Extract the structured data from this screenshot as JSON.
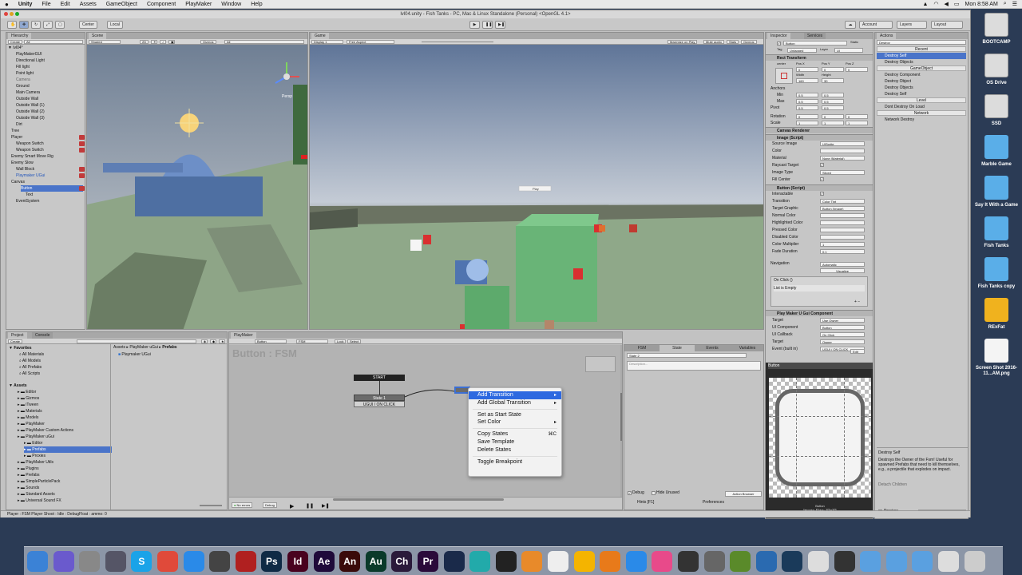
{
  "menubar": {
    "apple": "",
    "items": [
      "Unity",
      "File",
      "Edit",
      "Assets",
      "GameObject",
      "Component",
      "PlayMaker",
      "Window",
      "Help"
    ],
    "clock": "Mon 8:58 AM"
  },
  "window": {
    "title": "lvl04.unity - Fish Tanks - PC, Mac & Linux Standalone (Personal) <OpenGL 4.1>",
    "center_label": "Center",
    "local_label": "Local",
    "account": "Account",
    "layers": "Layers",
    "layout": "Layout"
  },
  "hierarchy": {
    "tab": "Hierarchy",
    "create": "Create",
    "search": "All",
    "scene": "lvl04*",
    "items": [
      {
        "label": "PlayMakerGUI",
        "indent": 1,
        "cls": "",
        "badge": false
      },
      {
        "label": "Directional Light",
        "indent": 1,
        "cls": "",
        "badge": false
      },
      {
        "label": "Fill light",
        "indent": 1,
        "cls": "",
        "badge": false
      },
      {
        "label": "Point light",
        "indent": 1,
        "cls": "",
        "badge": false
      },
      {
        "label": "Camera",
        "indent": 1,
        "cls": "grey",
        "badge": false
      },
      {
        "label": "Ground",
        "indent": 1,
        "cls": "",
        "badge": false
      },
      {
        "label": "Main Camera",
        "indent": 1,
        "cls": "",
        "badge": false
      },
      {
        "label": "Outside Wall",
        "indent": 1,
        "cls": "",
        "badge": false
      },
      {
        "label": "Outside Wall (1)",
        "indent": 1,
        "cls": "",
        "badge": false
      },
      {
        "label": "Outside Wall (2)",
        "indent": 1,
        "cls": "",
        "badge": false
      },
      {
        "label": "Outside Wall (3)",
        "indent": 1,
        "cls": "",
        "badge": false
      },
      {
        "label": "Dirt",
        "indent": 1,
        "cls": "",
        "badge": false
      },
      {
        "label": "Tree",
        "indent": 0,
        "cls": "",
        "badge": false
      },
      {
        "label": "Player",
        "indent": 0,
        "cls": "",
        "badge": true
      },
      {
        "label": "Weapon Switch",
        "indent": 1,
        "cls": "",
        "badge": true
      },
      {
        "label": "Weapon Switch",
        "indent": 1,
        "cls": "",
        "badge": true
      },
      {
        "label": "Enemy Smart Move Rig",
        "indent": 0,
        "cls": "",
        "badge": false
      },
      {
        "label": "Enemy Slow",
        "indent": 0,
        "cls": "",
        "badge": false
      },
      {
        "label": "Wall Block",
        "indent": 1,
        "cls": "",
        "badge": true
      },
      {
        "label": "Playmaker UGui",
        "indent": 1,
        "cls": "blue",
        "badge": true
      },
      {
        "label": "Canvas",
        "indent": 0,
        "cls": "",
        "badge": false
      },
      {
        "label": "Button",
        "indent": 2,
        "cls": "sel",
        "badge": true
      },
      {
        "label": "Text",
        "indent": 3,
        "cls": "",
        "badge": false
      },
      {
        "label": "EventSystem",
        "indent": 1,
        "cls": "",
        "badge": false
      }
    ]
  },
  "scene": {
    "tab": "Scene",
    "shading": "Shaded",
    "mode": "2D",
    "gizmos": "Gizmos",
    "search": "All",
    "persp": "Persp"
  },
  "game": {
    "tab": "Game",
    "display": "Display 1",
    "aspect": "Free Aspect",
    "maximize": "Maximize on Play",
    "mute": "Mute audio",
    "stats": "Stats",
    "gizmos": "Gizmos",
    "ui_button": "Play"
  },
  "inspector": {
    "tab": "Inspector",
    "services": "Services",
    "name": "Button",
    "static": "Static",
    "tag_label": "Tag",
    "tag": "Untagged",
    "layer_label": "Layer",
    "layer": "UI",
    "rect_transform": "Rect Transform",
    "anchor_preset": "center",
    "pos_x_lbl": "Pos X",
    "pos_y_lbl": "Pos Y",
    "pos_z_lbl": "Pos Z",
    "pos_x": "0",
    "pos_y": "0",
    "pos_z": "0",
    "width_lbl": "Width",
    "height_lbl": "Height",
    "width": "160",
    "height": "30",
    "anchors": "Anchors",
    "min": "Min",
    "max": "Max",
    "pivot": "Pivot",
    "anchor_min_x": "0.5",
    "anchor_min_y": "0.5",
    "anchor_max_x": "0.5",
    "anchor_max_y": "0.5",
    "pivot_x": "0.5",
    "pivot_y": "0.5",
    "rotation": "Rotation",
    "scale": "Scale",
    "rot_x": "0",
    "rot_y": "0",
    "rot_z": "0",
    "scale_x": "1",
    "scale_y": "1",
    "scale_z": "1",
    "canvas_renderer": "Canvas Renderer",
    "image_script": "Image (Script)",
    "image_fields": [
      {
        "label": "Source Image",
        "value": "UISprite"
      },
      {
        "label": "Color",
        "value": ""
      },
      {
        "label": "Material",
        "value": "None (Material)"
      },
      {
        "label": "Raycast Target",
        "value": "check"
      },
      {
        "label": "Image Type",
        "value": "Sliced"
      },
      {
        "label": "Fill Center",
        "value": "check"
      }
    ],
    "button_script": "Button (Script)",
    "button_fields": [
      {
        "label": "Interactable",
        "value": "check"
      },
      {
        "label": "Transition",
        "value": "Color Tint"
      },
      {
        "label": "Target Graphic",
        "value": "Button (Image)"
      },
      {
        "label": "Normal Color",
        "value": ""
      },
      {
        "label": "Highlighted Color",
        "value": ""
      },
      {
        "label": "Pressed Color",
        "value": ""
      },
      {
        "label": "Disabled Color",
        "value": ""
      },
      {
        "label": "Color Multiplier",
        "value": "1"
      },
      {
        "label": "Fade Duration",
        "value": "0.1"
      }
    ],
    "navigation": "Navigation",
    "navigation_value": "Automatic",
    "visualize": "Visualize",
    "onclick": "On Click ()",
    "list_empty": "List is Empty",
    "pm_component": "Play Maker U Gui Component",
    "pm_fields": [
      {
        "label": "Target",
        "value": "Use Owner"
      },
      {
        "label": "UI Component",
        "value": "Button"
      },
      {
        "label": "UI Callback",
        "value": "On Click"
      },
      {
        "label": "Target",
        "value": "Owner"
      },
      {
        "label": "Event (built in)",
        "value": "UGUI / ON CLICK"
      }
    ],
    "edit": "Edit",
    "preview_title": "Button",
    "preview_name": "Button",
    "image_size": "Image Size: 32x32"
  },
  "actions": {
    "tab": "Actions",
    "search": "Destroy",
    "sections": [
      {
        "header": "Recent",
        "items": [
          "Destroy Self",
          "Destroy Objects"
        ]
      },
      {
        "header": "GameObject",
        "items": [
          "Destroy Component",
          "Destroy Object",
          "Destroy Objects",
          "Destroy Self"
        ]
      },
      {
        "header": "Level",
        "items": [
          "Dont Destroy On Load"
        ]
      },
      {
        "header": "Network",
        "items": [
          "Network Destroy"
        ]
      }
    ],
    "selected": "Destroy Self",
    "desc_title": "Destroy Self",
    "description": "Destroys the Owner of the Fsm! Useful for spawned Prefabs that need to kill themselves, e.g., a projectile that explodes on impact.",
    "detach": "Detach Children",
    "preview": "Preview",
    "add_action": "Add Action To State"
  },
  "project": {
    "tab": "Project",
    "console": "Console",
    "create": "Create",
    "favorites": "Favorites",
    "fav_items": [
      "All Materials",
      "All Models",
      "All Prefabs",
      "All Scripts"
    ],
    "assets": "Assets",
    "asset_items": [
      {
        "label": "Editor",
        "indent": 1
      },
      {
        "label": "Gizmos",
        "indent": 1
      },
      {
        "label": "iTween",
        "indent": 1
      },
      {
        "label": "Materials",
        "indent": 1
      },
      {
        "label": "Models",
        "indent": 1
      },
      {
        "label": "PlayMaker",
        "indent": 1
      },
      {
        "label": "PlayMaker Custom Actions",
        "indent": 1
      },
      {
        "label": "PlayMaker uGui",
        "indent": 1
      },
      {
        "label": "Editor",
        "indent": 2
      },
      {
        "label": "Prefabs",
        "indent": 2
      },
      {
        "label": "Proxies",
        "indent": 2
      },
      {
        "label": "PlayMaker Utils",
        "indent": 1
      },
      {
        "label": "Plugins",
        "indent": 1
      },
      {
        "label": "Prefabs",
        "indent": 1
      },
      {
        "label": "SimpleParticlePack",
        "indent": 1
      },
      {
        "label": "Sounds",
        "indent": 1
      },
      {
        "label": "Standard Assets",
        "indent": 1
      },
      {
        "label": "Universal Sound FX",
        "indent": 1
      }
    ],
    "breadcrumb": [
      "Assets",
      "PlayMaker uGui",
      "Prefabs"
    ],
    "file": "Playmaker UGui"
  },
  "playmaker": {
    "tab": "PlayMaker",
    "object": "Button",
    "fsm": "FSM",
    "lock": "Lock",
    "select": "Select",
    "title": "Button : FSM",
    "start": "START",
    "state1": "State 1",
    "event1": "UGUI / ON CLICK",
    "side_tabs": [
      "FSM",
      "State",
      "Events",
      "Variables"
    ],
    "state_name": "State 2",
    "description": "Description...",
    "debug": "Debug",
    "hide_unused": "Hide Unused",
    "action_browser": "Action Browser",
    "hints": "Hints [F1]",
    "preferences": "Preferences",
    "no_errors": "No errors",
    "debug_btn": "Debug"
  },
  "context_menu": [
    {
      "label": "Add Transition",
      "arrow": true,
      "highlight": true
    },
    {
      "label": "Add Global Transition",
      "arrow": true
    },
    {
      "sep": true
    },
    {
      "label": "Set as Start State"
    },
    {
      "label": "Set Color",
      "arrow": true
    },
    {
      "sep": true
    },
    {
      "label": "Copy States",
      "shortcut": "⌘C"
    },
    {
      "label": "Save Template"
    },
    {
      "label": "Delete States"
    },
    {
      "sep": true
    },
    {
      "label": "Toggle Breakpoint"
    }
  ],
  "statusbar": "Player : FSM Player Shoot : Idle : DebugFloat : ammo: 0",
  "desktop": [
    {
      "label": "BOOTCAMP",
      "kind": "drive"
    },
    {
      "label": "OS Drive",
      "kind": "drive"
    },
    {
      "label": "SSD",
      "kind": "drive"
    },
    {
      "label": "Marble Game",
      "kind": "folder"
    },
    {
      "label": "Say It With a Game",
      "kind": "folder"
    },
    {
      "label": "Fish Tanks",
      "kind": "folder"
    },
    {
      "label": "Fish Tanks copy",
      "kind": "folder"
    },
    {
      "label": "RExFat",
      "kind": "ydrive"
    },
    {
      "label": "Screen Shot 2016-11...AM.png",
      "kind": "file"
    }
  ],
  "dock": [
    {
      "label": "",
      "color": "#3b82d6"
    },
    {
      "label": "",
      "color": "#6a5acd"
    },
    {
      "label": "",
      "color": "#888"
    },
    {
      "label": "",
      "color": "#556"
    },
    {
      "label": "S",
      "color": "#1aa3e8"
    },
    {
      "label": "",
      "color": "#e04a3a"
    },
    {
      "label": "",
      "color": "#2a8ae8"
    },
    {
      "label": "",
      "color": "#444"
    },
    {
      "label": "",
      "color": "#b02020"
    },
    {
      "label": "Ps",
      "color": "#0f2a45"
    },
    {
      "label": "Id",
      "color": "#49021f"
    },
    {
      "label": "Ae",
      "color": "#1f0a3a"
    },
    {
      "label": "An",
      "color": "#3a0a0a"
    },
    {
      "label": "Au",
      "color": "#0a3a2a"
    },
    {
      "label": "Ch",
      "color": "#2a1a3a"
    },
    {
      "label": "Pr",
      "color": "#2a0a3a"
    },
    {
      "label": "",
      "color": "#1a2a4a"
    },
    {
      "label": "",
      "color": "#2aa"
    },
    {
      "label": "",
      "color": "#222"
    },
    {
      "label": "",
      "color": "#e88a2a"
    },
    {
      "label": "",
      "color": "#eee"
    },
    {
      "label": "",
      "color": "#f4b400"
    },
    {
      "label": "",
      "color": "#e87a1a"
    },
    {
      "label": "",
      "color": "#2a8ae8"
    },
    {
      "label": "",
      "color": "#e84a8a"
    },
    {
      "label": "",
      "color": "#333"
    },
    {
      "label": "",
      "color": "#666"
    },
    {
      "label": "",
      "color": "#5a8a2a"
    },
    {
      "label": "",
      "color": "#2a6ab0"
    },
    {
      "label": "",
      "color": "#1a3a5a"
    },
    {
      "label": "",
      "color": "#ddd"
    },
    {
      "label": "",
      "color": "#333"
    },
    {
      "label": "",
      "color": "#5aa0e0"
    },
    {
      "label": "",
      "color": "#5aa0e0"
    },
    {
      "label": "",
      "color": "#5aa0e0"
    },
    {
      "label": "",
      "color": "#ddd"
    },
    {
      "label": "",
      "color": "#ccc"
    }
  ]
}
